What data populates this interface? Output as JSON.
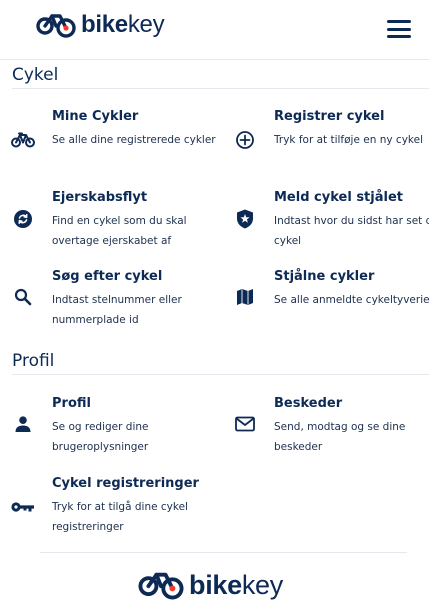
{
  "brand": {
    "bold": "bike",
    "light": "key"
  },
  "colors": {
    "navy": "#0d2a55",
    "brand_accent": "#f23b2f",
    "rule": "#e5e8ee"
  },
  "sections": [
    {
      "title": "Cykel",
      "items": [
        {
          "title": "Mine Cykler",
          "desc": "Se alle dine registrerede cykler",
          "icon": "bicycle-icon"
        },
        {
          "title": "Registrer cykel",
          "desc": "Tryk for at tilføje en ny cykel",
          "icon": "plus-circle-icon"
        },
        {
          "title": "Ejerskabsflyt",
          "desc": "Find en cykel som du skal overtage ejerskabet af",
          "icon": "transfer-icon"
        },
        {
          "title": "Meld cykel stjålet",
          "desc": "Indtast hvor du sidst har set din cykel",
          "icon": "shield-star-icon"
        },
        {
          "title": "Søg efter cykel",
          "desc": "Indtast stelnummer eller nummerplade id",
          "icon": "search-icon"
        },
        {
          "title": "Stjålne cykler",
          "desc": "Se alle anmeldte cykeltyverier",
          "icon": "map-icon"
        }
      ]
    },
    {
      "title": "Profil",
      "items": [
        {
          "title": "Profil",
          "desc": "Se og rediger dine brugeroplysninger",
          "icon": "person-icon"
        },
        {
          "title": "Beskeder",
          "desc": "Send, modtag og se dine beskeder",
          "icon": "mail-icon"
        },
        {
          "title": "Cykel registreringer",
          "desc": "Tryk for at tilgå dine cykel registreringer",
          "icon": "key-icon"
        }
      ]
    }
  ]
}
